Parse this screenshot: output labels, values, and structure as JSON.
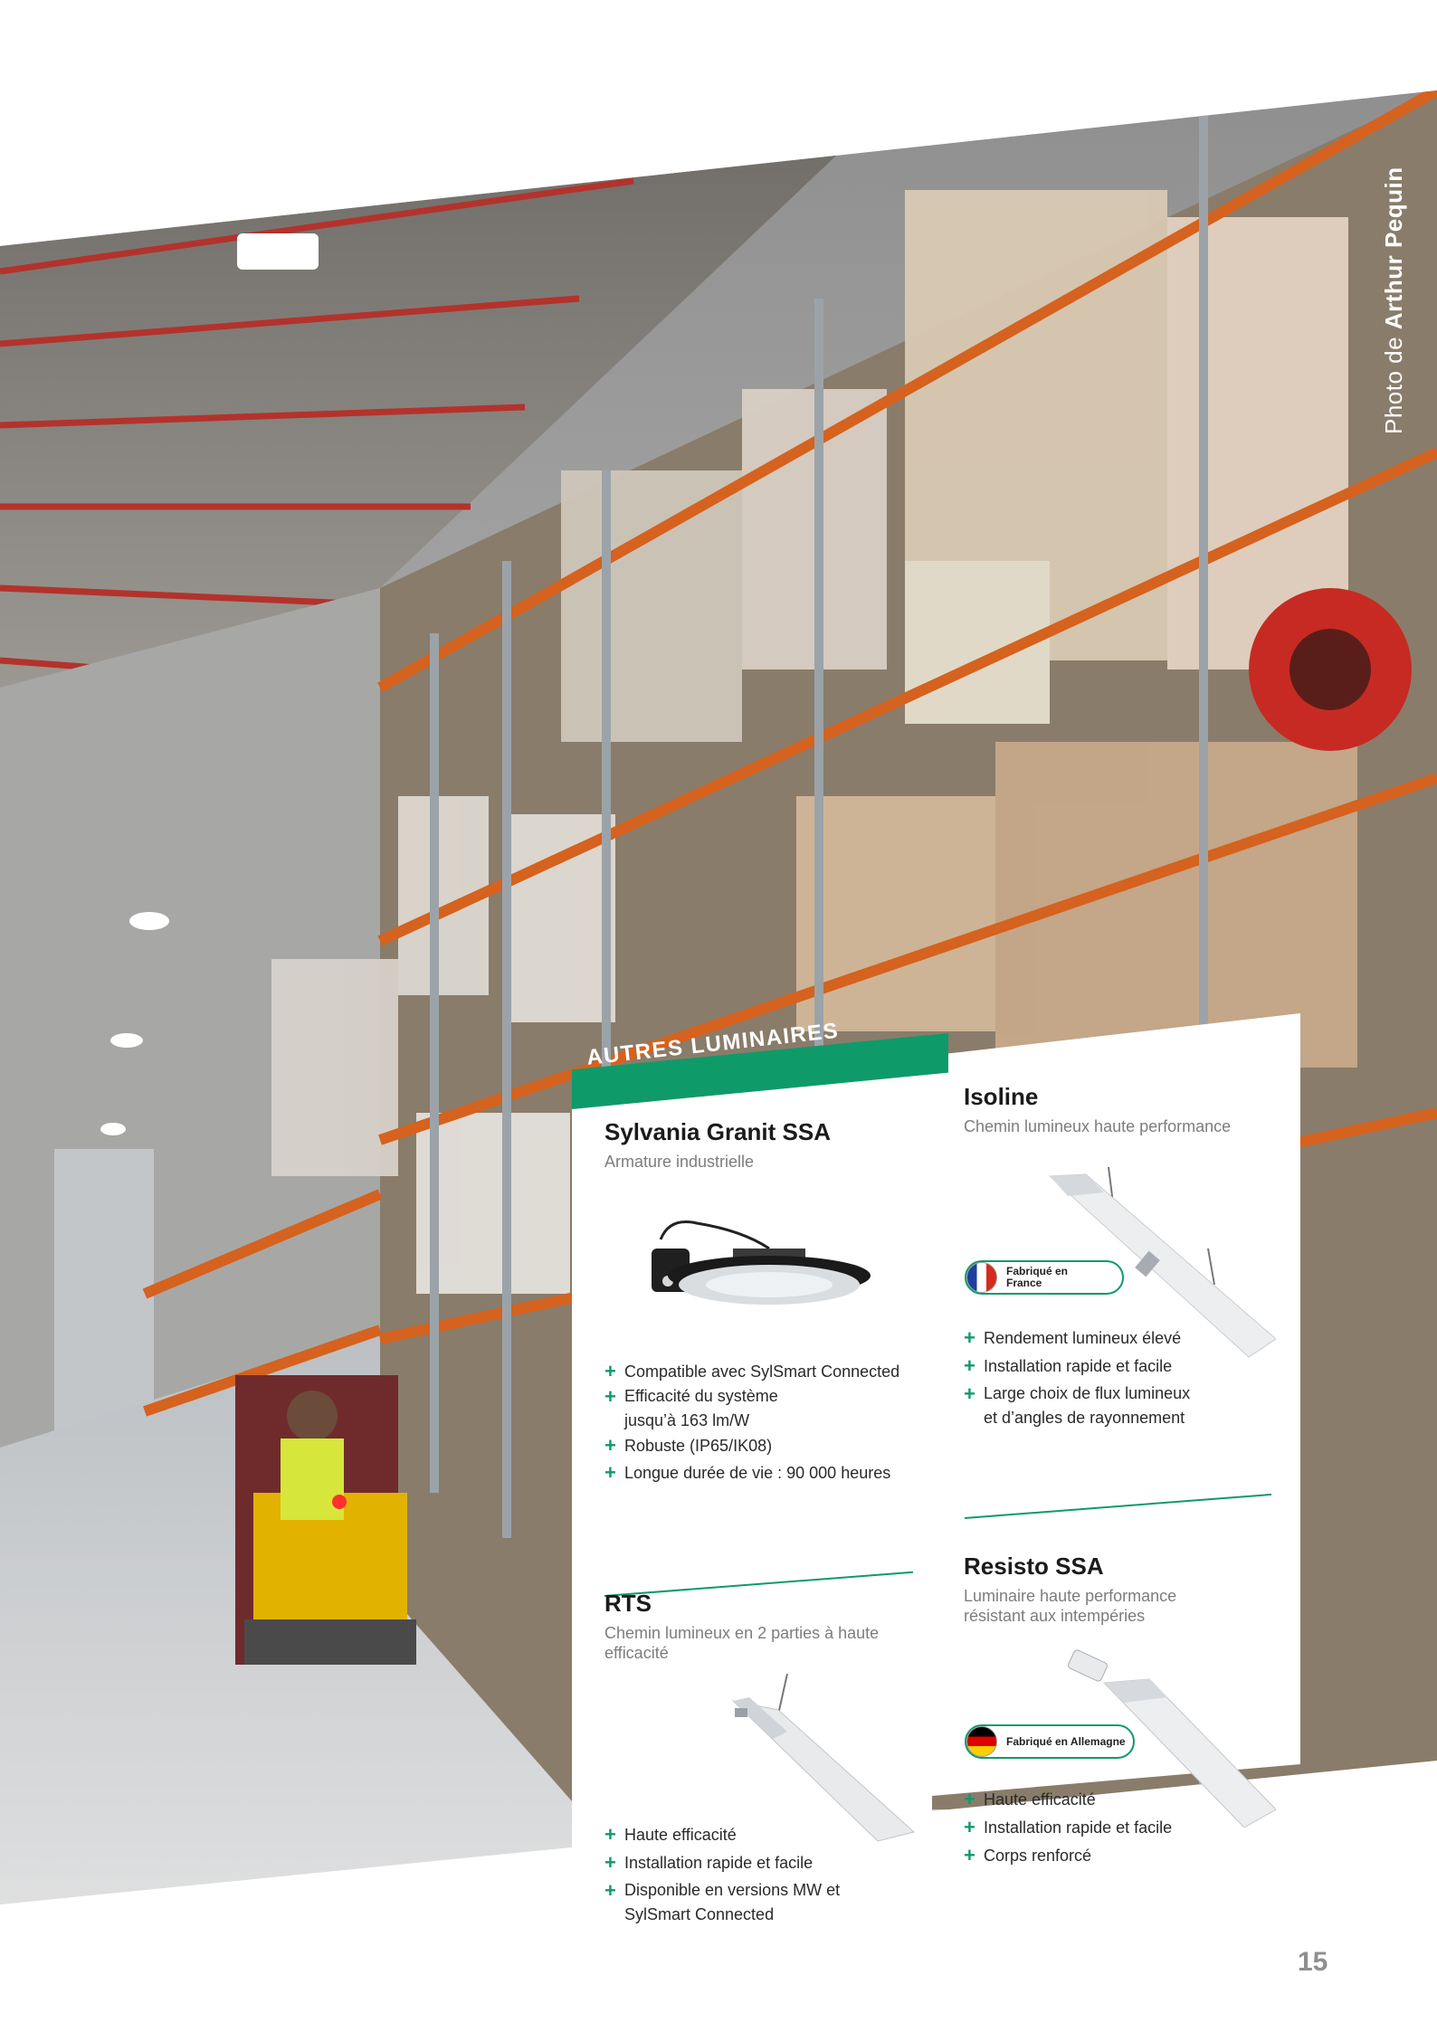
{
  "photo": {
    "credit_prefix": "Photo de ",
    "credit_name": "Arthur Pequin"
  },
  "section": {
    "banner": "AUTRES LUMINAIRES"
  },
  "products": [
    {
      "name": "Sylvania Granit SSA",
      "subtitle": "Armature industrielle",
      "features": [
        "Compatible avec SylSmart Connected",
        "Efficacité du système jusqu’à 163 lm/W",
        "Robuste (IP65/IK08)",
        "Longue durée de vie : 90 000 heures"
      ]
    },
    {
      "name": "Isoline",
      "subtitle": "Chemin lumineux haute performance",
      "badge": "Fabriqué en France",
      "features": [
        "Rendement lumineux élevé",
        "Installation rapide et facile",
        "Large choix de flux lumineux et d’angles de rayonnement"
      ]
    },
    {
      "name": "RTS",
      "subtitle": "Chemin lumineux en 2 parties à haute efficacité",
      "features": [
        "Haute efficacité",
        "Installation rapide et facile",
        "Disponible en versions MW et SylSmart Connected"
      ]
    },
    {
      "name": "Resisto SSA",
      "subtitle": "Luminaire haute performance résistant aux intempéries",
      "badge": "Fabriqué en Allemagne",
      "features": [
        "Haute efficacité",
        "Installation rapide et facile",
        "Corps renforcé"
      ]
    }
  ],
  "bullet_symbol": "+",
  "page_number": "15",
  "colors": {
    "accent_green": "#0f9a6a",
    "rack_orange": "#d5621e",
    "page_number_gray": "#8f8f8f"
  },
  "icons": [
    "highbay-luminaire-image",
    "linear-luminaire-image",
    "france-flag-icon",
    "germany-flag-icon",
    "plus-icon"
  ]
}
